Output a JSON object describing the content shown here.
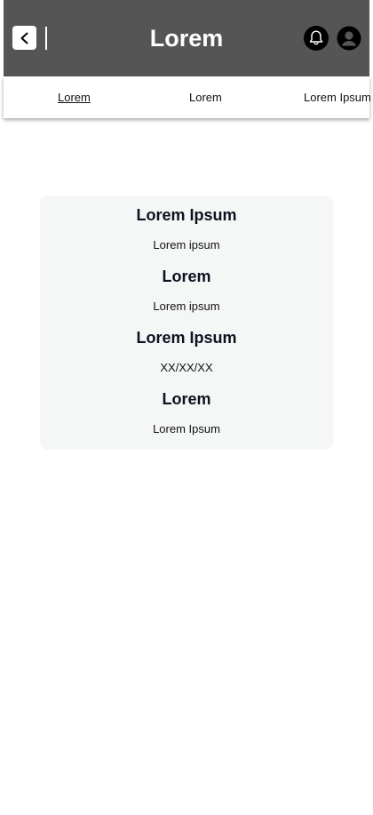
{
  "header": {
    "title": "Lorem",
    "back_icon": "chevron-left-icon",
    "notification_icon": "bell-icon",
    "profile_icon": "user-icon",
    "background_color": "#555555"
  },
  "tabs": [
    {
      "label": "Lorem",
      "active": true
    },
    {
      "label": "Lorem",
      "active": false
    },
    {
      "label": "Lorem Ipsum",
      "active": false
    }
  ],
  "card": {
    "background_color": "#f4f7f6",
    "items": [
      {
        "heading": "Lorem Ipsum",
        "value": "Lorem ipsum"
      },
      {
        "heading": "Lorem",
        "value": "Lorem ipsum"
      },
      {
        "heading": "Lorem Ipsum",
        "value": "XX/XX/XX"
      },
      {
        "heading": "Lorem",
        "value": "Lorem Ipsum"
      }
    ]
  }
}
